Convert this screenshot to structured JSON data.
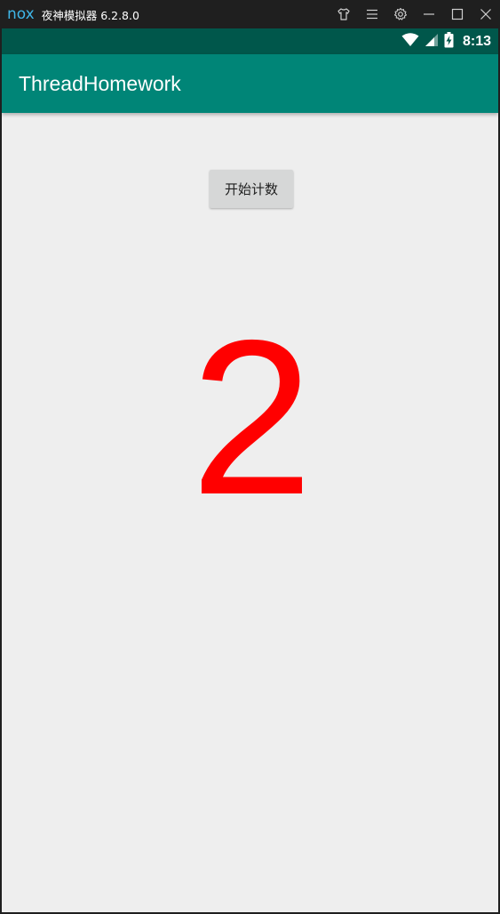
{
  "emulator": {
    "logo": "nox",
    "title": "夜神模拟器 6.2.8.0",
    "controls": [
      "shirt-icon",
      "menu-icon",
      "settings-icon",
      "minimize-icon",
      "maximize-icon",
      "close-icon"
    ],
    "logo_color": "#3fb6e8"
  },
  "status_bar": {
    "time": "8:13",
    "icons": [
      "wifi-icon",
      "signal-icon",
      "battery-charging-icon"
    ],
    "color": "#00574b"
  },
  "app_bar": {
    "title": "ThreadHomework",
    "color": "#008577"
  },
  "main": {
    "start_button_label": "开始计数",
    "counter_value": "2",
    "counter_color": "#ff0000",
    "background": "#eeeeee"
  }
}
